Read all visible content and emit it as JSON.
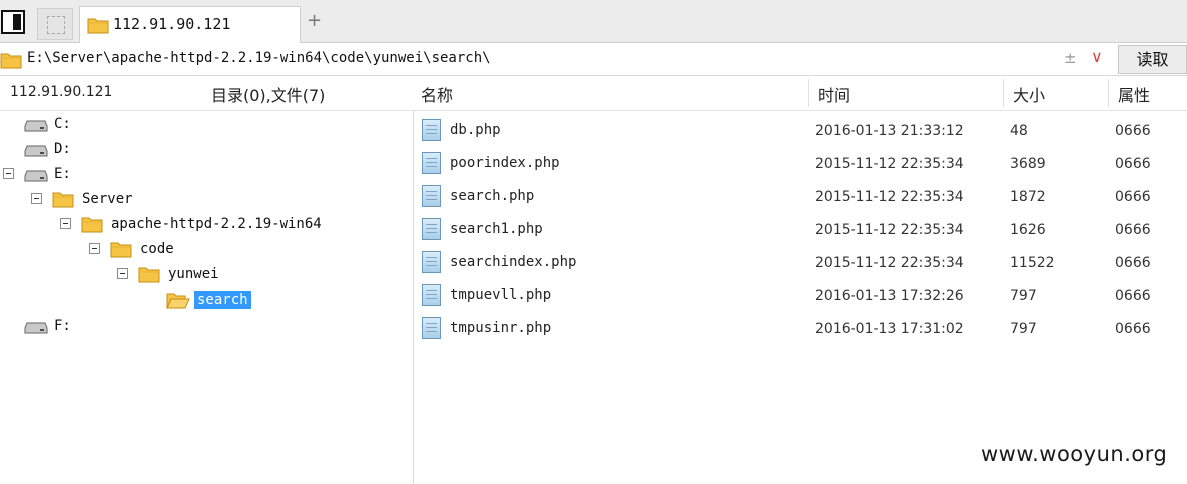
{
  "tabbar": {
    "tab_label": "112.91.90.121",
    "add_symbol": "+"
  },
  "address": {
    "path": "E:\\Server\\apache-httpd-2.2.19-win64\\code\\yunwei\\search\\",
    "plus_minus": "±",
    "dropdown_symbol": "∨",
    "read_button": "读取"
  },
  "header": {
    "host": "112.91.90.121",
    "count": "目录(0),文件(7)",
    "columns": {
      "name": "名称",
      "time": "时间",
      "size": "大小",
      "attr": "属性"
    }
  },
  "tree": [
    {
      "label": "C:",
      "type": "drive"
    },
    {
      "label": "D:",
      "type": "drive"
    },
    {
      "label": "E:",
      "type": "drive"
    },
    {
      "label": "Server",
      "type": "folder"
    },
    {
      "label": "apache-httpd-2.2.19-win64",
      "type": "folder"
    },
    {
      "label": "code",
      "type": "folder"
    },
    {
      "label": "yunwei",
      "type": "folder"
    },
    {
      "label": "search",
      "type": "folder",
      "selected": true
    },
    {
      "label": "F:",
      "type": "drive"
    }
  ],
  "files": [
    {
      "name": "db.php",
      "time": "2016-01-13 21:33:12",
      "size": "48",
      "attr": "0666"
    },
    {
      "name": "poorindex.php",
      "time": "2015-11-12 22:35:34",
      "size": "3689",
      "attr": "0666"
    },
    {
      "name": "search.php",
      "time": "2015-11-12 22:35:34",
      "size": "1872",
      "attr": "0666"
    },
    {
      "name": "search1.php",
      "time": "2015-11-12 22:35:34",
      "size": "1626",
      "attr": "0666"
    },
    {
      "name": "searchindex.php",
      "time": "2015-11-12 22:35:34",
      "size": "11522",
      "attr": "0666"
    },
    {
      "name": "tmpuevll.php",
      "time": "2016-01-13 17:32:26",
      "size": "797",
      "attr": "0666"
    },
    {
      "name": "tmpusinr.php",
      "time": "2016-01-13 17:31:02",
      "size": "797",
      "attr": "0666"
    }
  ],
  "watermark": "www.wooyun.org",
  "colors": {
    "selection": "#3399ff",
    "folder": "#f5c445",
    "dropdown": "#d04848"
  }
}
